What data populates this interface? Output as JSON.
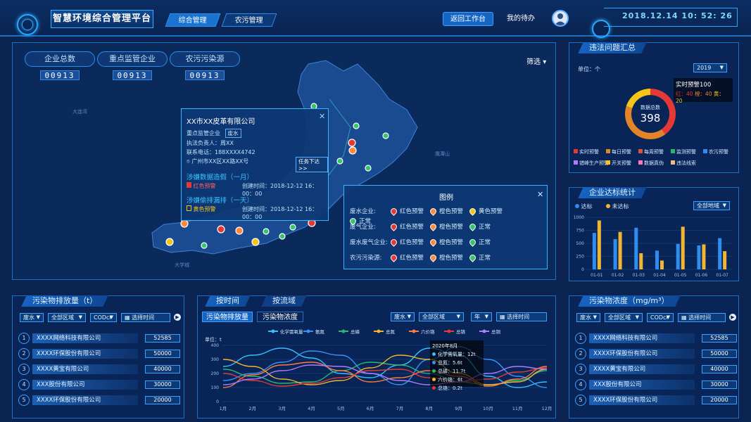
{
  "header": {
    "title": "智慧环境综合管理平台",
    "tabs": [
      {
        "label": "综合管理",
        "active": true
      },
      {
        "label": "农污管理",
        "active": false
      }
    ],
    "workspace_btn": "返回工作台",
    "my_todo": "我的待办",
    "clock": "2018.12.14  10: 52: 26"
  },
  "map": {
    "stats": [
      {
        "label": "企业总数",
        "value": "00913"
      },
      {
        "label": "重点监管企业",
        "value": "00913"
      },
      {
        "label": "农污污染源",
        "value": "00913"
      }
    ],
    "filter_label": "筛选",
    "popup": {
      "company": "XX市XX皮革有限公司",
      "category": "重点监管企业",
      "tag": "废水",
      "responsible": "执法负责人：周XX",
      "phone": "联系电话：188XXXX4742",
      "address": "广州市XX区XX路XX号",
      "assign_btn": "任务下达>>",
      "case1_title": "涉嫌数据造假（一月）",
      "case1_status": "红色预警",
      "case1_time": "创建时间：2018-12-12   16：00：00",
      "case2_title": "涉嫌偷排漏排（一天）",
      "case2_status": "黄色预警",
      "case2_time": "创建时间：2018-12-12   16：00：00"
    },
    "legend": {
      "title": "图例",
      "rows": [
        {
          "label": "废水企业:",
          "items": [
            {
              "name": "红色预警",
              "color": "#e53935"
            },
            {
              "name": "橙色预警",
              "color": "#ff8a3d"
            },
            {
              "name": "黄色预警",
              "color": "#f5c518"
            },
            {
              "name": "正常",
              "color": "#37c46b"
            }
          ]
        },
        {
          "label": "废气企业:",
          "items": [
            {
              "name": "红色预警",
              "color": "#e53935"
            },
            {
              "name": "橙色预警",
              "color": "#ff8a3d"
            },
            {
              "name": "正常",
              "color": "#37c46b"
            }
          ]
        },
        {
          "label": "废水废气企业:",
          "items": [
            {
              "name": "红色预警",
              "color": "#e53935"
            },
            {
              "name": "橙色预警",
              "color": "#ff8a3d"
            },
            {
              "name": "正常",
              "color": "#37c46b"
            }
          ]
        },
        {
          "label": "农污污染源:",
          "items": [
            {
              "name": "红色预警",
              "color": "#e53935"
            },
            {
              "name": "橙色预警",
              "color": "#ff8a3d"
            },
            {
              "name": "正常",
              "color": "#37c46b"
            }
          ]
        }
      ]
    }
  },
  "issues": {
    "title": "违法问题汇总",
    "unit": "单位：个",
    "year": "2019",
    "center_label": "数据总数",
    "center_value": "398",
    "tooltip": {
      "title": "实时预警100",
      "red": "红：40",
      "orange": "橙：40",
      "yellow": "黄：20"
    },
    "legend": [
      {
        "name": "实时预警",
        "color": "#e53935"
      },
      {
        "name": "每日预警",
        "color": "#e3832a"
      },
      {
        "name": "每周预警",
        "color": "#e0503a"
      },
      {
        "name": "监测预警",
        "color": "#2bb673"
      },
      {
        "name": "农污预警",
        "color": "#2f8df0"
      },
      {
        "name": "错峰生产预警",
        "color": "#b07bff"
      },
      {
        "name": "开关预警",
        "color": "#f5c518"
      },
      {
        "name": "数据真伪",
        "color": "#ff77b4"
      },
      {
        "name": "违法线索",
        "color": "#f4b880"
      }
    ],
    "donut": [
      {
        "name": "红",
        "value": 40,
        "color": "#e53935"
      },
      {
        "name": "橙",
        "value": 40,
        "color": "#e3832a"
      },
      {
        "name": "黄",
        "value": 20,
        "color": "#f5c518"
      }
    ]
  },
  "standard": {
    "title": "企业达标统计",
    "legend_ok": "达标",
    "legend_bad": "未达标",
    "region": "全部地域",
    "chart_data": {
      "type": "bar",
      "categories": [
        "01-01",
        "01-02",
        "01-03",
        "01-04",
        "01-05",
        "01-06",
        "01-07"
      ],
      "series": [
        {
          "name": "达标",
          "color": "#2f8df0",
          "values": [
            700,
            580,
            800,
            360,
            490,
            460,
            600
          ]
        },
        {
          "name": "未达标",
          "color": "#f2b531",
          "values": [
            940,
            720,
            310,
            170,
            820,
            480,
            350
          ]
        }
      ],
      "ylim": [
        0,
        1000
      ],
      "yticks": [
        "0",
        "250",
        "500",
        "750",
        "1000"
      ]
    }
  },
  "emission": {
    "title": "污染物排放量（t）",
    "filters": [
      "废水",
      "全部区域",
      "CODcr",
      "选择时间"
    ],
    "rows": [
      {
        "rank": "1",
        "name": "XXXX网络科技有限公司",
        "value": "52585"
      },
      {
        "rank": "2",
        "name": "XXXX环保股份有限公司",
        "value": "50000"
      },
      {
        "rank": "3",
        "name": "XXXX黄宝有限公司",
        "value": "40000"
      },
      {
        "rank": "4",
        "name": "XXX股份有限公司",
        "value": "30000"
      },
      {
        "rank": "5",
        "name": "XXXX环保股份有限公司",
        "value": "20000"
      }
    ]
  },
  "trend": {
    "top_tabs": [
      "按时间",
      "按流域"
    ],
    "sub_tabs": [
      "污染物排放量",
      "污染物浓度"
    ],
    "filters": [
      "废水",
      "全部区域",
      "年",
      "选择时间"
    ],
    "unit": "单位：t",
    "tooltip": {
      "title": "2020年8月",
      "lines": [
        "化学需氧量：12t",
        "总氮：5.6t",
        "总磷：11.7t",
        "六价铬：6t",
        "总铬：0.2t"
      ],
      "colors": [
        "#34c0ff",
        "#3c8ff7",
        "#2bb673",
        "#f2b531",
        "#e53935"
      ]
    },
    "chart_data": {
      "type": "line",
      "categories": [
        "1月",
        "2月",
        "3月",
        "4月",
        "5月",
        "6月",
        "7月",
        "8月",
        "9月",
        "10月",
        "11月",
        "12月"
      ],
      "ylim": [
        0,
        400
      ],
      "yticks": [
        "0",
        "100",
        "200",
        "300",
        "400"
      ],
      "series": [
        {
          "name": "化学需氧量",
          "color": "#34c0ff",
          "values": [
            250,
            330,
            380,
            310,
            200,
            170,
            260,
            380,
            330,
            180,
            100,
            140
          ]
        },
        {
          "name": "氨氮",
          "color": "#3c8ff7",
          "values": [
            150,
            200,
            280,
            360,
            330,
            200,
            120,
            300,
            390,
            300,
            180,
            100
          ]
        },
        {
          "name": "总磷",
          "color": "#2bb673",
          "values": [
            230,
            180,
            130,
            140,
            220,
            280,
            260,
            200,
            140,
            120,
            150,
            220
          ]
        },
        {
          "name": "总氮",
          "color": "#f2b531",
          "values": [
            300,
            250,
            160,
            120,
            150,
            240,
            330,
            300,
            200,
            120,
            140,
            230
          ]
        },
        {
          "name": "六价铬",
          "color": "#ff7a3d",
          "values": [
            100,
            190,
            260,
            280,
            220,
            140,
            170,
            220,
            180,
            110,
            160,
            250
          ]
        },
        {
          "name": "总铬",
          "color": "#e53935",
          "values": [
            200,
            150,
            110,
            130,
            170,
            220,
            230,
            170,
            140,
            160,
            210,
            240
          ]
        },
        {
          "name": "总铜",
          "color": "#b07bff",
          "values": [
            120,
            160,
            220,
            260,
            250,
            200,
            150,
            120,
            140,
            200,
            250,
            230
          ]
        }
      ]
    }
  },
  "concentration": {
    "title": "污染物浓度（mg/m³）",
    "filters": [
      "废水",
      "全部区域",
      "CODcr",
      "选择时间"
    ],
    "rows": [
      {
        "rank": "1",
        "name": "XXXX网络科技有限公司",
        "value": "52585"
      },
      {
        "rank": "2",
        "name": "XXXX环保股份有限公司",
        "value": "50000"
      },
      {
        "rank": "3",
        "name": "XXXX黄宝有限公司",
        "value": "40000"
      },
      {
        "rank": "4",
        "name": "XXX股份有限公司",
        "value": "30000"
      },
      {
        "rank": "5",
        "name": "XXXX环保股份有限公司",
        "value": "20000"
      }
    ]
  }
}
